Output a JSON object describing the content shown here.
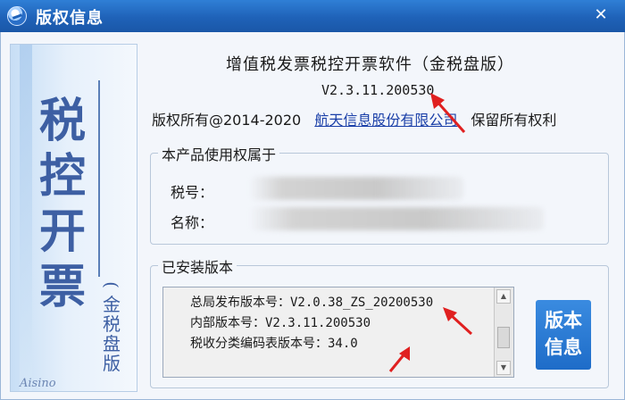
{
  "window": {
    "title": "版权信息",
    "close_symbol": "✕"
  },
  "banner": {
    "big_chars": [
      "税",
      "控",
      "开",
      "票"
    ],
    "small_chars": [
      "(",
      "金",
      "税",
      "盘",
      "版"
    ],
    "logo_text": "Aisino"
  },
  "header": {
    "product_name": "增值税发票税控开票软件（金税盘版）",
    "version": "V2.3.11.200530",
    "copyright_prefix": "版权所有@2014-2020",
    "company_link": "航天信息股份有限公司",
    "rights_reserved": "保留所有权利"
  },
  "owner_group": {
    "legend": "本产品使用权属于",
    "tax_id_label": "税号：",
    "name_label": "名称："
  },
  "install_group": {
    "legend": "已安装版本",
    "lines": [
      {
        "label": "总局发布版本号：",
        "value": "V2.0.38_ZS_20200530"
      },
      {
        "label": "内部版本号：",
        "value": "V2.3.11.200530"
      },
      {
        "label": "税收分类编码表版本号：",
        "value": "34.0"
      }
    ],
    "info_button_lines": [
      "版本",
      "信息"
    ]
  },
  "icons": {
    "app": "app-logo-icon",
    "close": "close-icon",
    "scroll_up": "chevron-up-icon",
    "scroll_down": "chevron-down-icon"
  },
  "colors": {
    "titlebar": "#1f62b8",
    "link": "#1a3fa8",
    "button": "#1e6cc8",
    "annotation_arrow": "#e02020"
  }
}
